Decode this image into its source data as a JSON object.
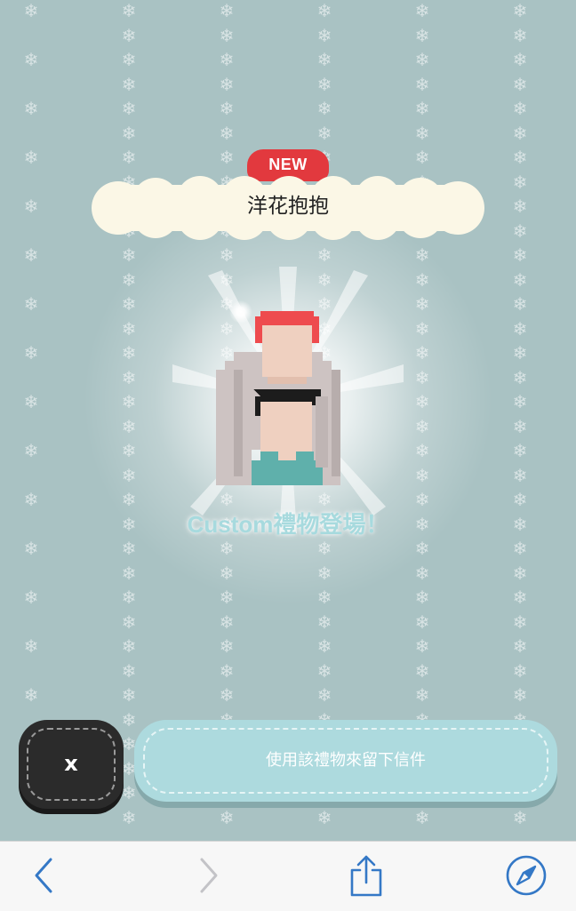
{
  "badge": {
    "label": "NEW"
  },
  "gift": {
    "title": "洋花抱抱"
  },
  "subtitle": "Custom禮物登場！",
  "actions": {
    "close_label": "x",
    "use_gift_label": "使用該禮物來留下信件"
  },
  "browser_toolbar": {
    "items": [
      {
        "icon": "chevron-left-icon",
        "enabled": true
      },
      {
        "icon": "chevron-right-icon",
        "enabled": false
      },
      {
        "icon": "share-icon",
        "enabled": true
      },
      {
        "icon": "compass-icon",
        "enabled": true
      }
    ]
  },
  "colors": {
    "background": "#a9c2c3",
    "badge": "#e2393e",
    "title_cloud": "#fbf7e6",
    "action_button": "#addade",
    "close_button": "#2b2b2b",
    "toolbar_icon": "#3478c6"
  }
}
